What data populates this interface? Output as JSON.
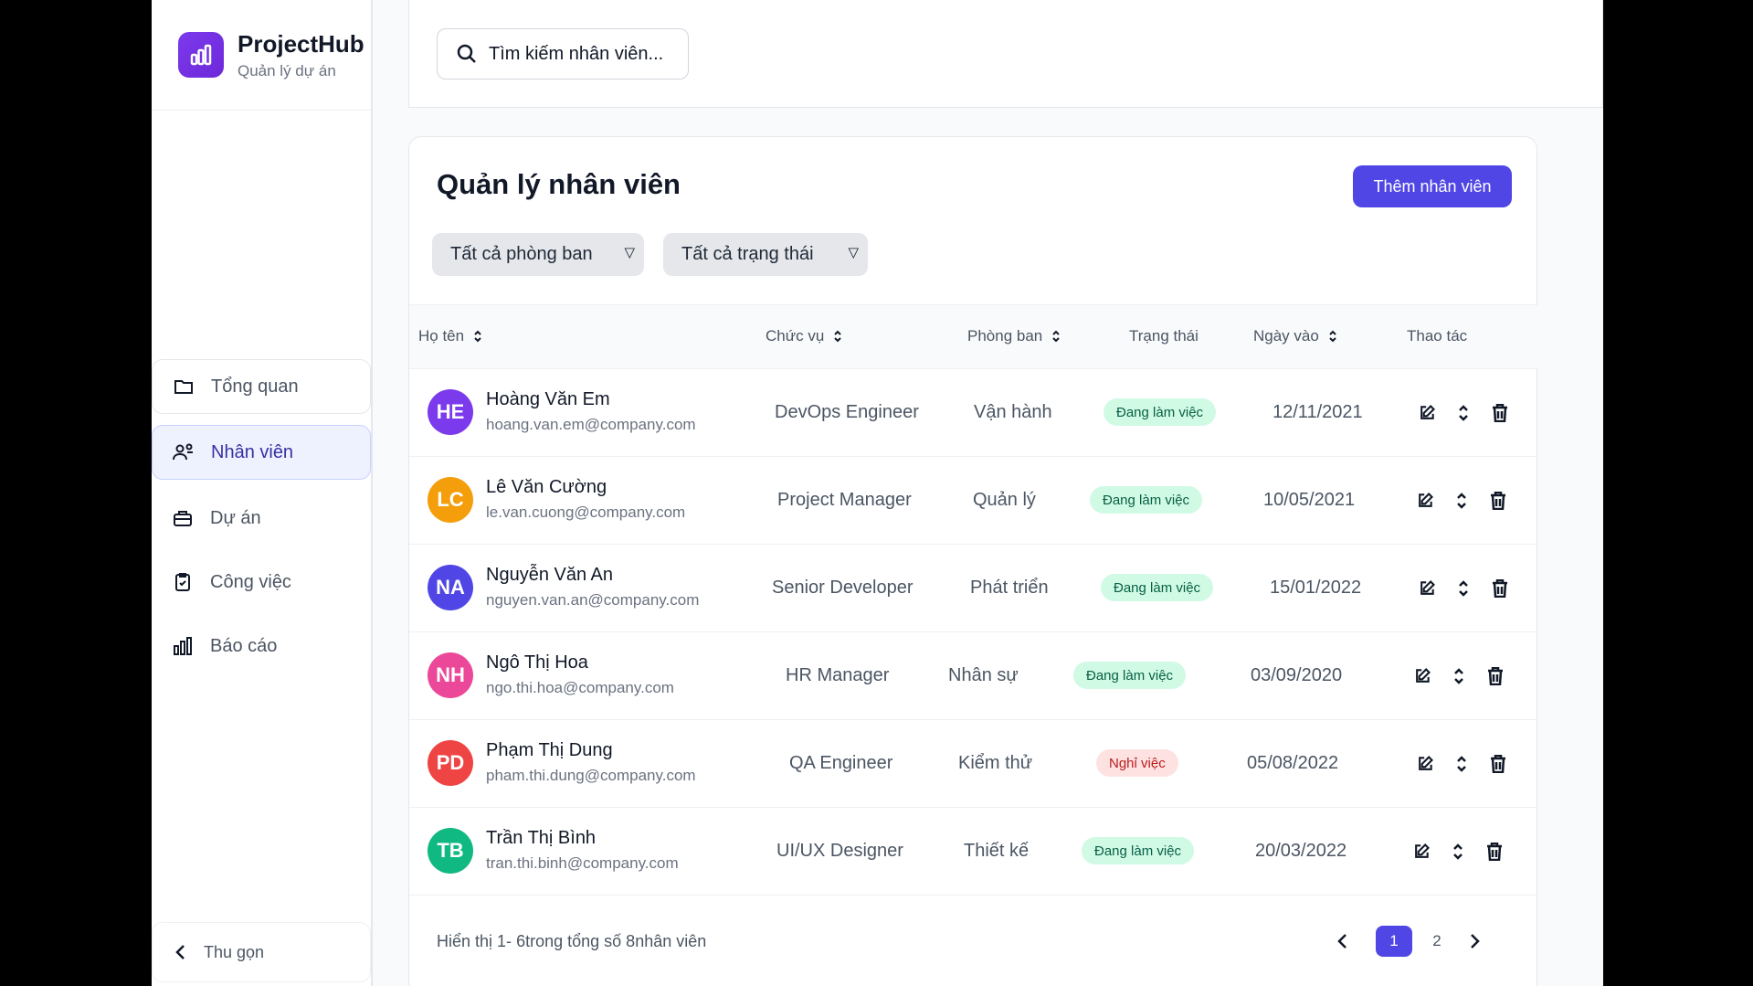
{
  "brand": {
    "name": "ProjectHub",
    "subtitle": "Quản lý dự án"
  },
  "sidebar": {
    "items": [
      {
        "label": "Tổng quan",
        "icon": "folder-icon"
      },
      {
        "label": "Nhân viên",
        "icon": "users-icon",
        "active": true
      },
      {
        "label": "Dự án",
        "icon": "briefcase-icon"
      },
      {
        "label": "Công việc",
        "icon": "clipboard-check-icon"
      },
      {
        "label": "Báo cáo",
        "icon": "bar-chart-icon"
      }
    ],
    "collapse_label": "Thu gọn"
  },
  "search": {
    "placeholder": "Tìm kiếm nhân viên..."
  },
  "main": {
    "title": "Quản lý nhân viên",
    "add_button": "Thêm nhân viên",
    "filters": {
      "department": "Tất cả phòng ban",
      "status": "Tất cả trạng thái"
    },
    "columns": {
      "name": "Họ tên",
      "position": "Chức vụ",
      "department": "Phòng ban",
      "status": "Trạng thái",
      "join_date": "Ngày vào",
      "actions": "Thao tác"
    },
    "rows": [
      {
        "initials": "HE",
        "name": "Hoàng Văn Em",
        "email": "hoang.van.em@company.com",
        "position": "DevOps Engineer",
        "department": "Vận hành",
        "status": "Đang làm việc",
        "join_date": "12/11/2021",
        "avatar_color": "#7c3aed"
      },
      {
        "initials": "LC",
        "name": "Lê Văn Cường",
        "email": "le.van.cuong@company.com",
        "position": "Project Manager",
        "department": "Quản lý",
        "status": "Đang làm việc",
        "join_date": "10/05/2021",
        "avatar_color": "#f59e0b"
      },
      {
        "initials": "NA",
        "name": "Nguyễn Văn An",
        "email": "nguyen.van.an@company.com",
        "position": "Senior Developer",
        "department": "Phát triển",
        "status": "Đang làm việc",
        "join_date": "15/01/2022",
        "avatar_color": "#4f46e5"
      },
      {
        "initials": "NH",
        "name": "Ngô Thị Hoa",
        "email": "ngo.thi.hoa@company.com",
        "position": "HR Manager",
        "department": "Nhân sự",
        "status": "Đang làm việc",
        "join_date": "03/09/2020",
        "avatar_color": "#ec4899"
      },
      {
        "initials": "PD",
        "name": "Phạm Thị Dung",
        "email": "pham.thi.dung@company.com",
        "position": "QA Engineer",
        "department": "Kiểm thử",
        "status": "Nghỉ việc",
        "join_date": "05/08/2022",
        "avatar_color": "#ef4444"
      },
      {
        "initials": "TB",
        "name": "Trần Thị Bình",
        "email": "tran.thi.binh@company.com",
        "position": "UI/UX Designer",
        "department": "Thiết kế",
        "status": "Đang làm việc",
        "join_date": "20/03/2022",
        "avatar_color": "#10b981"
      }
    ],
    "pagination": {
      "info_prefix": "Hiển thị 1-",
      "info_shown": "6",
      "info_middle": "trong tổng số",
      "info_total": "8",
      "info_suffix": "nhân viên",
      "pages": [
        "1",
        "2"
      ],
      "current_page": "1"
    }
  },
  "colors": {
    "accent": "#4f46e5",
    "active_bg": "#eef2ff",
    "ok_badge_bg": "#d1fae5",
    "off_badge_bg": "#fee2e2"
  }
}
